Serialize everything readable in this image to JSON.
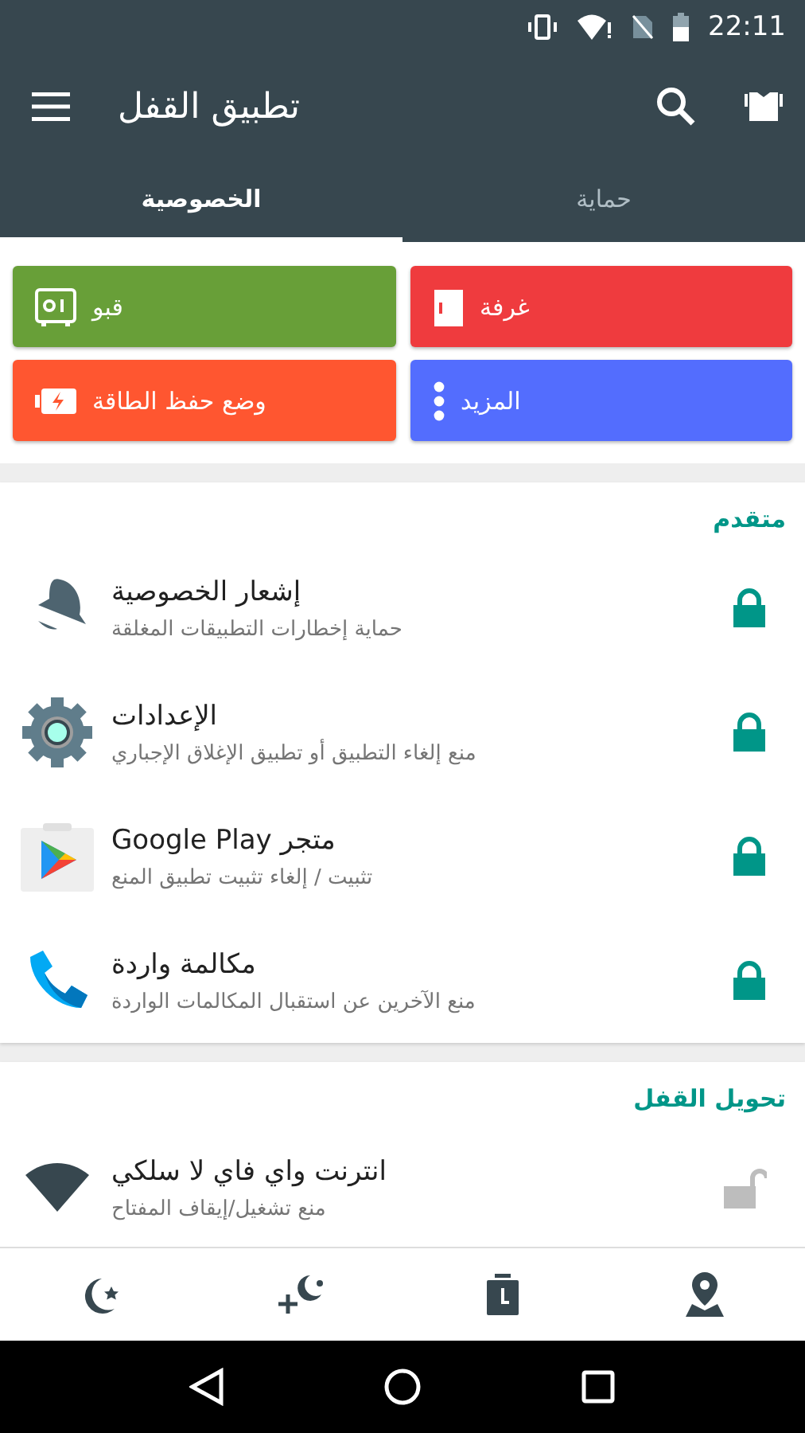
{
  "status_bar": {
    "time": "22:11"
  },
  "toolbar": {
    "title": "تطبيق القفل"
  },
  "tabs": [
    {
      "label": "حماية",
      "selected": false
    },
    {
      "label": "الخصوصية",
      "selected": true
    }
  ],
  "tiles": [
    {
      "label": "غرفة",
      "kind": "door",
      "color": "#ef3b3e"
    },
    {
      "label": "قبو",
      "kind": "safe",
      "color": "#689f38"
    },
    {
      "label": "المزيد",
      "kind": "more",
      "color": "#536dfe"
    },
    {
      "label": "وضع حفظ الطاقة",
      "kind": "battery",
      "color": "#ff5630"
    }
  ],
  "sections": [
    {
      "title": "متقدم",
      "items": [
        {
          "title": "إشعار الخصوصية",
          "subtitle": "حماية إخطارات التطبيقات المغلقة",
          "kind": "bell",
          "locked": true
        },
        {
          "title": "الإعدادات",
          "subtitle": "منع إلغاء التطبيق أو تطبيق الإغلاق الإجباري",
          "kind": "gear",
          "locked": true
        },
        {
          "title": "متجر Google Play",
          "subtitle": "تثبيت / إلغاء تثبيت تطبيق المنع",
          "kind": "store",
          "locked": true
        },
        {
          "title": "مكالمة واردة",
          "subtitle": "منع الآخرين عن استقبال المكالمات الواردة",
          "kind": "phone",
          "locked": true
        }
      ]
    },
    {
      "title": "تحويل القفل",
      "items": [
        {
          "title": "انترنت واي فاي لا سلكي",
          "subtitle": "منع تشغيل/إيقاف المفتاح",
          "kind": "wifi",
          "locked": false
        }
      ]
    }
  ]
}
